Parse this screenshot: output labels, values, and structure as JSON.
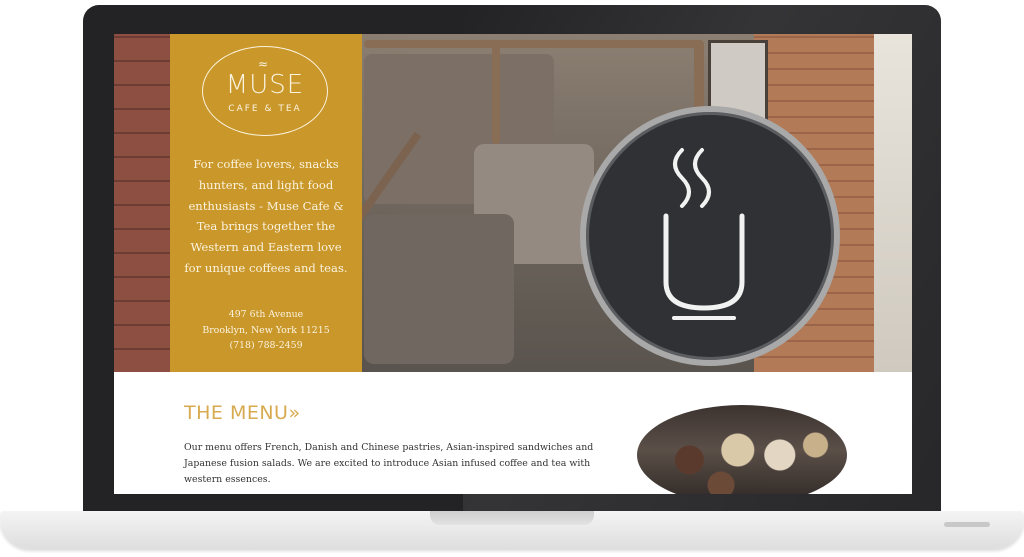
{
  "logo": {
    "steam": "≈",
    "title": "MUSE",
    "subtitle": "CAFE & TEA"
  },
  "tagline": "For coffee lovers, snacks hunters, and light food enthusiasts - Muse Cafe & Tea brings together the Western and Eastern love for unique coffees and teas.",
  "address": {
    "street": "497 6th Avenue",
    "city": "Brooklyn, New York 11215",
    "phone": "(718) 788-2459"
  },
  "menu": {
    "title": "THE MENU»",
    "description": "Our menu offers French, Danish and Chinese pastries, Asian-inspired sandwiches and Japanese fusion salads. We are excited to introduce Asian infused coffee and tea with western essences."
  },
  "colors": {
    "accent": "#c9972a",
    "heading": "#d8aa50",
    "laptop_frame": "#232325"
  }
}
